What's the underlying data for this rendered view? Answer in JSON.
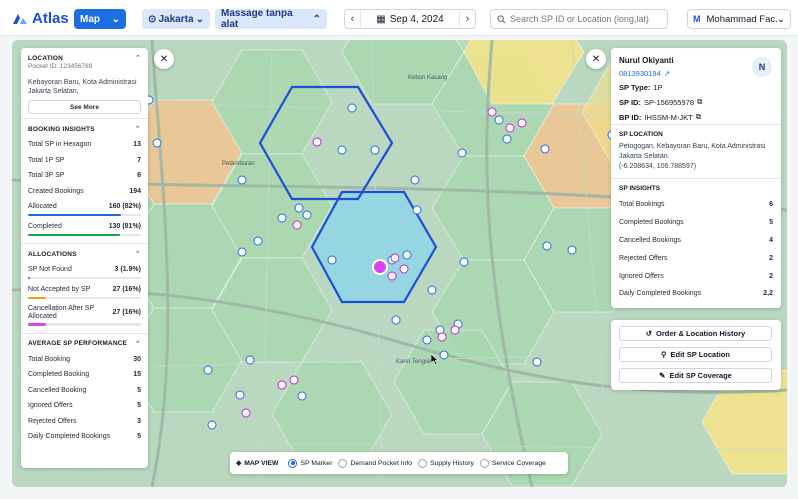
{
  "app": {
    "name": "Atlas"
  },
  "header": {
    "view_label": "Map",
    "city_label": "Jakarta",
    "service_label": "Massage tanpa alat",
    "date_label": "Sep 4, 2024",
    "search_placeholder": "Search SP ID or Location (long,lat)",
    "user_initial": "M",
    "user_name": "Mohammad Fac..."
  },
  "map_labels": {
    "kebon_kacang": "Kebon Kacang",
    "petamburan": "Petamburan",
    "karet_tengsin": "Karet Tengsin"
  },
  "location_panel": {
    "title": "LOCATION",
    "pocket_id": "Pocket ID: 123456789",
    "address": "Kebayoran Baru, Kota Administrasi Jakarta Selatan,",
    "see_more": "See More"
  },
  "booking_insights": {
    "title": "BOOKING INSIGHTS",
    "rows": [
      {
        "label": "Total SP in Hexagon",
        "value": "13"
      },
      {
        "label": "Total 1P SP",
        "value": "7"
      },
      {
        "label": "Total 3P SP",
        "value": "6"
      },
      {
        "label": "Created Bookings",
        "value": "194"
      },
      {
        "label": "Allocated",
        "value": "160 (82%)",
        "fill": 0.82,
        "color": "#1d6fe0"
      },
      {
        "label": "Completed",
        "value": "130 (81%)",
        "fill": 0.81,
        "color": "#16a34a"
      }
    ]
  },
  "allocations": {
    "title": "ALLOCATIONS",
    "rows": [
      {
        "label": "SP Not Found",
        "value": "3 (1.9%)",
        "fill": 0.019,
        "color": "#7c3aed"
      },
      {
        "label": "Not Accepted by SP",
        "value": "27 (16%)",
        "fill": 0.16,
        "color": "#f59e0b"
      },
      {
        "label": "Cancellation After SP Allocated",
        "value": "27 (16%)",
        "fill": 0.16,
        "color": "#d946ef"
      }
    ]
  },
  "avg_performance": {
    "title": "AVERAGE SP PERFORMANCE",
    "rows": [
      {
        "label": "Total Booking",
        "value": "30"
      },
      {
        "label": "Completed Booking",
        "value": "15"
      },
      {
        "label": "Cancelled Booking",
        "value": "5"
      },
      {
        "label": "Ignored Offers",
        "value": "5"
      },
      {
        "label": "Rejected Offers",
        "value": "3"
      },
      {
        "label": "Daily Completed Bookings",
        "value": "5"
      }
    ]
  },
  "sp_detail": {
    "name": "Nurul Okiyanti",
    "phone": "0813930194",
    "avatar": "N",
    "sp_type_label": "SP Type:",
    "sp_type": "1P",
    "sp_id_label": "SP ID:",
    "sp_id": "SP-156955978",
    "bp_id_label": "BP ID:",
    "bp_id": "IHSSM-M-JKT",
    "location_title": "SP LOCATION",
    "location_text": "Petogogan, Kebayoran Baru, Kota Administrasi Jakarta Selatan.",
    "coords": "(-6.208634, 106.788597)",
    "insights_title": "SP INSIGHTS",
    "insights": [
      {
        "label": "Total Bookings",
        "value": "6"
      },
      {
        "label": "Completed Bookings",
        "value": "5"
      },
      {
        "label": "Cancelled Bookings",
        "value": "4"
      },
      {
        "label": "Rejected Offers",
        "value": "2"
      },
      {
        "label": "Ignored Offers",
        "value": "2"
      },
      {
        "label": "Daily Completed Bookings",
        "value": "2,2"
      }
    ]
  },
  "actions": {
    "history": "Order & Location History",
    "edit_location": "Edit SP Location",
    "edit_coverage": "Edit SP Coverage"
  },
  "map_view": {
    "title": "MAP VIEW",
    "options": [
      "SP Marker",
      "Demand Pocket Info",
      "Supply History",
      "Service Coverage"
    ],
    "selected": "SP Marker"
  },
  "colors": {
    "accent": "#1d6fe0",
    "hex_green": "#9fd3a8",
    "hex_orange": "#f3c38e",
    "hex_yellow": "#f2e38a",
    "hex_selected": "#8fd6e8"
  }
}
